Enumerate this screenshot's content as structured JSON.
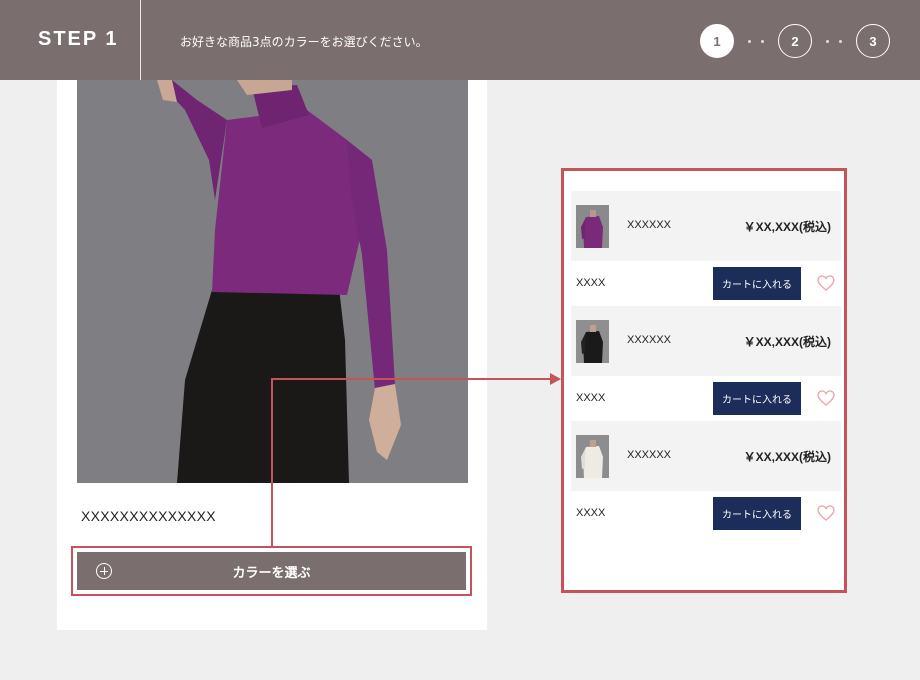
{
  "header": {
    "step_label": "STEP 1",
    "message": "お好きな商品3点のカラーをお選びください。",
    "steps": [
      "1",
      "2",
      "3"
    ],
    "active_step": 1
  },
  "product": {
    "name": "XXXXXXXXXXXXXX",
    "select_color_label": "カラーを選ぶ"
  },
  "color_panel": {
    "items": [
      {
        "name": "XXXXXX",
        "price": "￥XX,XXX(税込)",
        "size": "XXXX",
        "cart_label": "カートに入れる",
        "thumb_color": "#7a2a7a"
      },
      {
        "name": "XXXXXX",
        "price": "￥XX,XXX(税込)",
        "size": "XXXX",
        "cart_label": "カートに入れる",
        "thumb_color": "#1a1a1a"
      },
      {
        "name": "XXXXXX",
        "price": "￥XX,XXX(税込)",
        "size": "XXXX",
        "cart_label": "カートに入れる",
        "thumb_color": "#eeeae4"
      }
    ]
  },
  "colors": {
    "header_bg": "#7a6e6e",
    "accent_outline": "#c4535a",
    "cart_button": "#1c2d5a",
    "heart": "#e8a3a6"
  },
  "icons": {
    "plus": "plus-circle-icon",
    "heart": "heart-outline-icon",
    "arrow": "arrow-right-icon"
  }
}
